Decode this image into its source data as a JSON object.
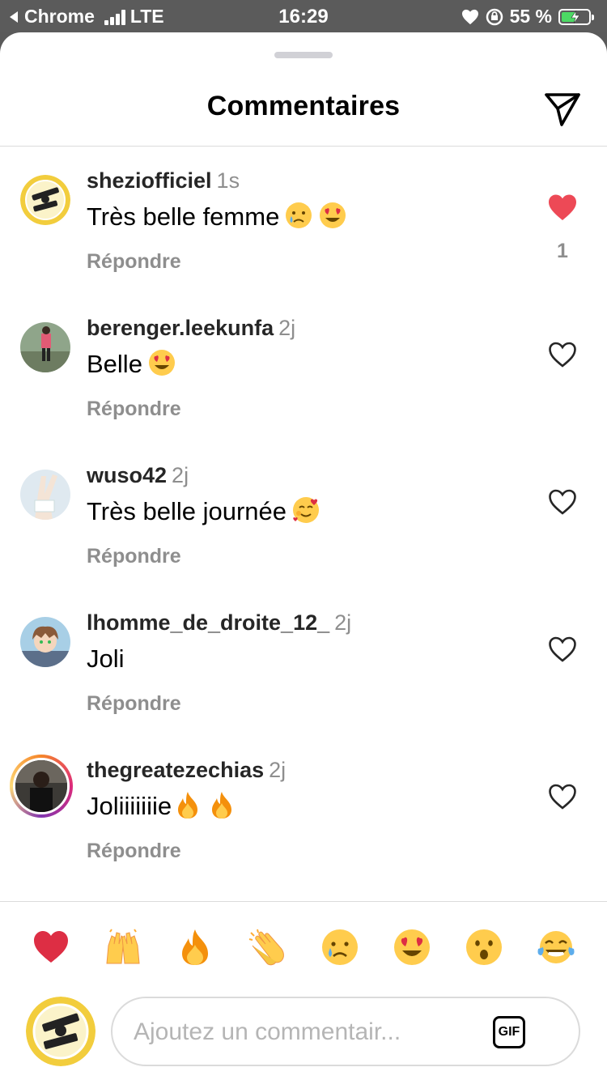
{
  "status_bar": {
    "back_app": "Chrome",
    "network": "LTE",
    "time": "16:29",
    "battery": "55 %",
    "battery_level": 0.55
  },
  "header": {
    "title": "Commentaires",
    "send_icon": "paper-plane-icon"
  },
  "comments": [
    {
      "username": "sheziofficiel",
      "time": "1s",
      "text": "Très belle femme",
      "emojis": [
        "crying-face",
        "heart-eyes"
      ],
      "reply": "Répondre",
      "liked": true,
      "like_count": "1"
    },
    {
      "username": "berenger.leekunfa",
      "time": "2j",
      "text": "Belle",
      "emojis": [
        "heart-eyes"
      ],
      "reply": "Répondre",
      "liked": false
    },
    {
      "username": "wuso42",
      "time": "2j",
      "text": "Très belle journée",
      "emojis": [
        "smiling-with-hearts"
      ],
      "reply": "Répondre",
      "liked": false
    },
    {
      "username": "lhomme_de_droite_12_",
      "time": "2j",
      "text": "Joli",
      "emojis": [],
      "reply": "Répondre",
      "liked": false
    },
    {
      "username": "thegreatezechias",
      "time": "2j",
      "text": "Joliiiiiiie",
      "emojis": [
        "fire",
        "fire"
      ],
      "reply": "Répondre",
      "liked": false
    }
  ],
  "quick_emojis": [
    "red-heart",
    "raising-hands",
    "fire",
    "clapping-hands",
    "crying-face",
    "heart-eyes",
    "surprised-face",
    "tears-of-joy"
  ],
  "composer": {
    "placeholder": "Ajoutez un commentair...",
    "gif_label": "GIF"
  },
  "colors": {
    "like_red": "#ed4956",
    "meta_gray": "#8e8e8e",
    "emoji_yellow": "#ffcc4d"
  }
}
